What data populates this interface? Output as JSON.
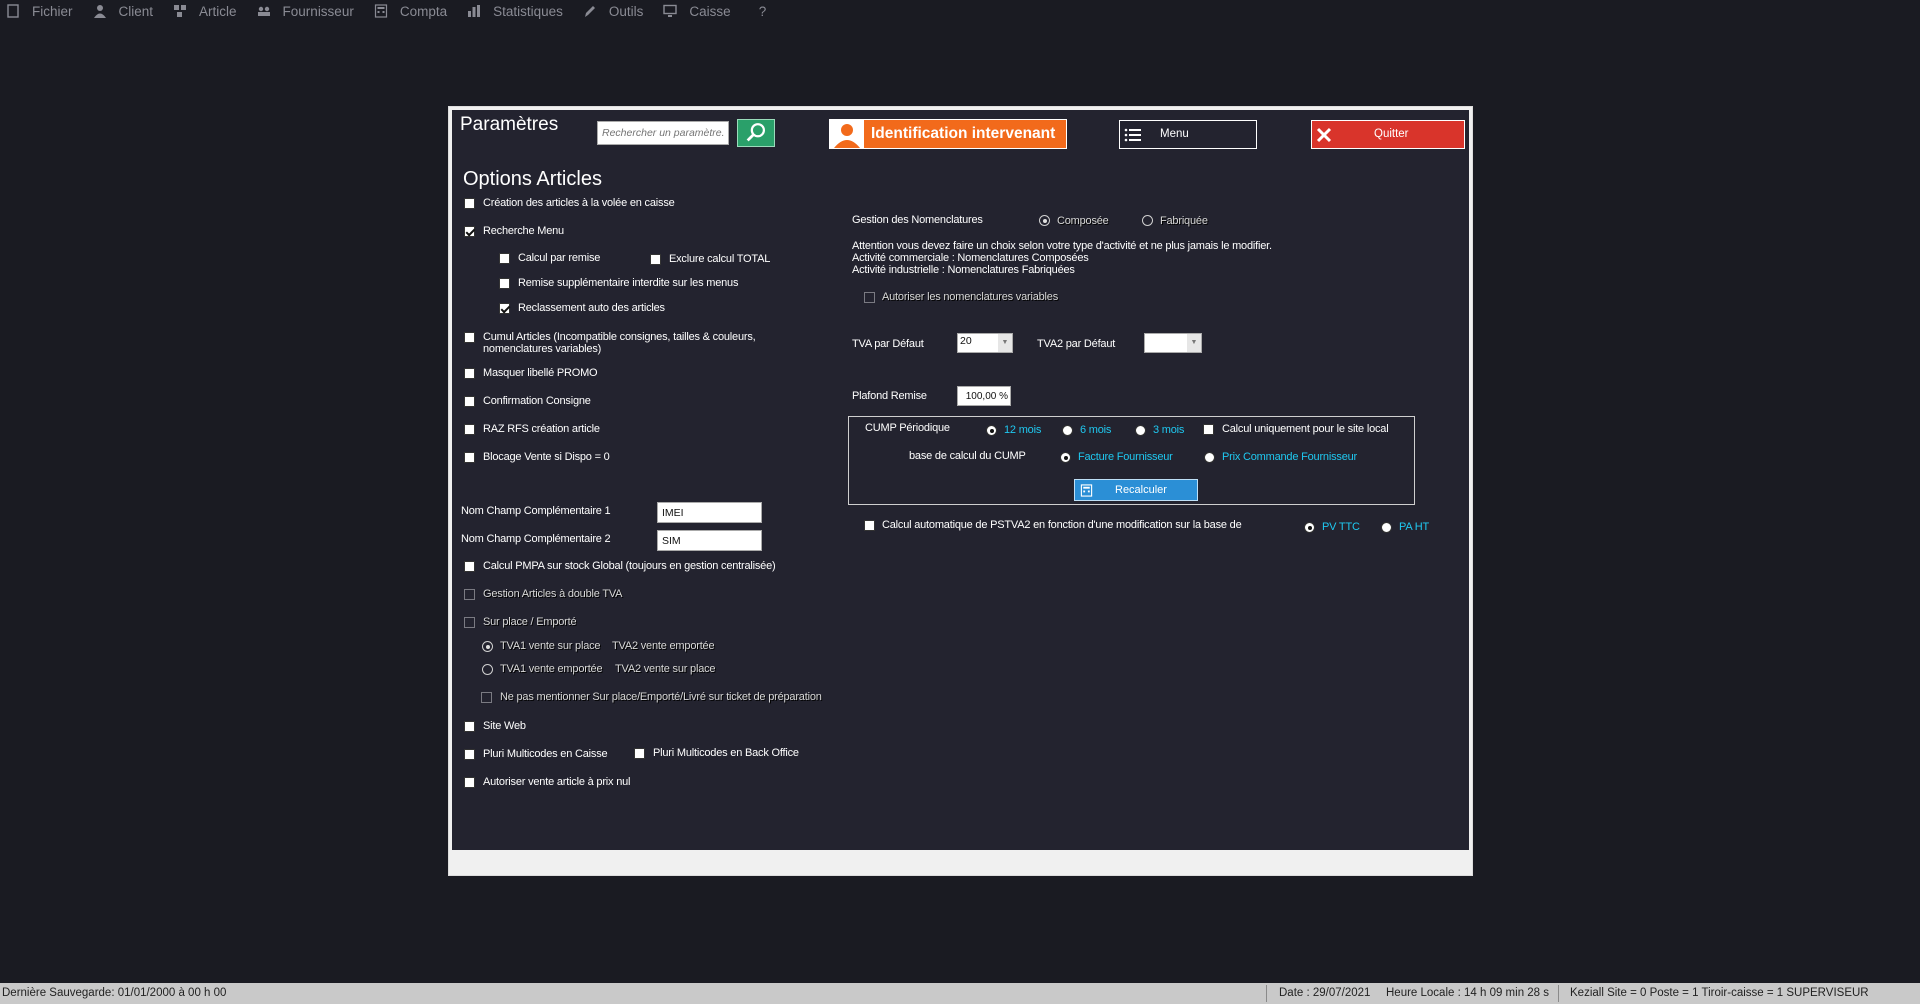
{
  "menubar": {
    "items": [
      {
        "label": "Fichier",
        "icon": "file-icon"
      },
      {
        "label": "Client",
        "icon": "user-icon"
      },
      {
        "label": "Article",
        "icon": "article-icon"
      },
      {
        "label": "Fournisseur",
        "icon": "users-icon"
      },
      {
        "label": "Compta",
        "icon": "calculator-icon"
      },
      {
        "label": "Statistiques",
        "icon": "bar-chart-icon"
      },
      {
        "label": "Outils",
        "icon": "pen-icon"
      },
      {
        "label": "Caisse",
        "icon": "monitor-icon"
      },
      {
        "label": "?",
        "icon": ""
      }
    ]
  },
  "dialog": {
    "title": "Paramètres",
    "search_placeholder": "Rechercher un paramètre...",
    "identification_label": "Identification intervenant",
    "menu_label": "Menu",
    "quit_label": "Quitter",
    "colors": {
      "identification_bg": "#f26a1b",
      "quit_bg": "#d9342b",
      "search_btn_bg": "#2aa06a",
      "recalc_bg": "#2b8fd6"
    }
  },
  "options": {
    "section_title": "Options Articles",
    "creation_volee": {
      "label": "Création des articles à la volée en caisse",
      "checked": false
    },
    "recherche_menu": {
      "label": "Recherche Menu",
      "checked": true
    },
    "calcul_remise": {
      "label": "Calcul par remise",
      "checked": false
    },
    "exclure_total": {
      "label": "Exclure calcul TOTAL",
      "checked": false
    },
    "remise_supp": {
      "label": "Remise supplémentaire interdite sur les menus",
      "checked": false
    },
    "reclassement": {
      "label": "Reclassement auto des articles",
      "checked": true
    },
    "cumul_articles": {
      "label_line1": "Cumul Articles (Incompatible consignes, tailles & couleurs,",
      "label_line2": "nomenclatures variables)",
      "checked": false
    },
    "masquer_promo": {
      "label": "Masquer libellé PROMO",
      "checked": false
    },
    "confirmation_consigne": {
      "label": "Confirmation Consigne",
      "checked": false
    },
    "raz_rfs": {
      "label": "RAZ RFS création article",
      "checked": false
    },
    "blocage_vente": {
      "label": "Blocage Vente si Dispo = 0",
      "checked": false
    },
    "champ1": {
      "label": "Nom Champ Complémentaire 1",
      "value": "IMEI"
    },
    "champ2": {
      "label": "Nom Champ Complémentaire 2",
      "value": "SIM"
    },
    "calcul_pmpa": {
      "label": "Calcul PMPA sur stock Global (toujours en gestion centralisée)",
      "checked": false
    },
    "double_tva": {
      "label": "Gestion Articles à double TVA",
      "checked": false
    },
    "sur_place": {
      "label": "Sur place / Emporté",
      "checked": false
    },
    "tva_opt1": {
      "label_a": "TVA1 vente sur place",
      "label_b": "TVA2 vente emportée",
      "selected": true
    },
    "tva_opt2": {
      "label_a": "TVA1 vente emportée",
      "label_b": "TVA2 vente sur place",
      "selected": false
    },
    "ne_pas_mentionner": {
      "label": "Ne pas mentionner Sur place/Emporté/Livré sur ticket de préparation",
      "checked": false
    },
    "site_web": {
      "label": "Site Web",
      "checked": false
    },
    "pluri_caisse": {
      "label": "Pluri Multicodes en Caisse",
      "checked": false
    },
    "pluri_back": {
      "label": "Pluri Multicodes en Back Office",
      "checked": false
    },
    "prix_nul": {
      "label": "Autoriser vente article à prix nul",
      "checked": false
    }
  },
  "right": {
    "nomenclatures_label": "Gestion des Nomenclatures",
    "composee": "Composée",
    "fabriquee": "Fabriquée",
    "attention_1": "Attention vous devez faire un choix selon votre type d'activité et ne plus jamais le modifier.",
    "attention_2": "Activité commerciale : Nomenclatures Composées",
    "attention_3": "Activité industrielle : Nomenclatures Fabriquées",
    "autoriser_variables": "Autoriser les nomenclatures variables",
    "tva_defaut_label": "TVA par Défaut",
    "tva_defaut_value": "20",
    "tva2_defaut_label": "TVA2 par Défaut",
    "tva2_defaut_value": "",
    "plafond_label": "Plafond Remise",
    "plafond_value": "100,00 %",
    "cump_label": "CUMP Périodique",
    "cump_12": "12 mois",
    "cump_6": "6 mois",
    "cump_3": "3 mois",
    "cump_site_local": "Calcul uniquement pour le site local",
    "base_calcul_label": "base de calcul du CUMP",
    "facture_fournisseur": "Facture Fournisseur",
    "prix_commande": "Prix Commande Fournisseur",
    "recalculer": "Recalculer",
    "pstva2_label": "Calcul automatique de PSTVA2 en fonction d'une modification sur la base de",
    "pv_ttc": "PV TTC",
    "pa_ht": "PA HT"
  },
  "statusbar": {
    "derniere_sauvegarde": "Dernière Sauvegarde: 01/01/2000 à 00 h 00",
    "date": "Date : 29/07/2021",
    "heure": "Heure Locale : 14 h 09 min 28 s",
    "session": "Keziall  Site = 0  Poste = 1  Tiroir-caisse = 1 SUPERVISEUR"
  }
}
